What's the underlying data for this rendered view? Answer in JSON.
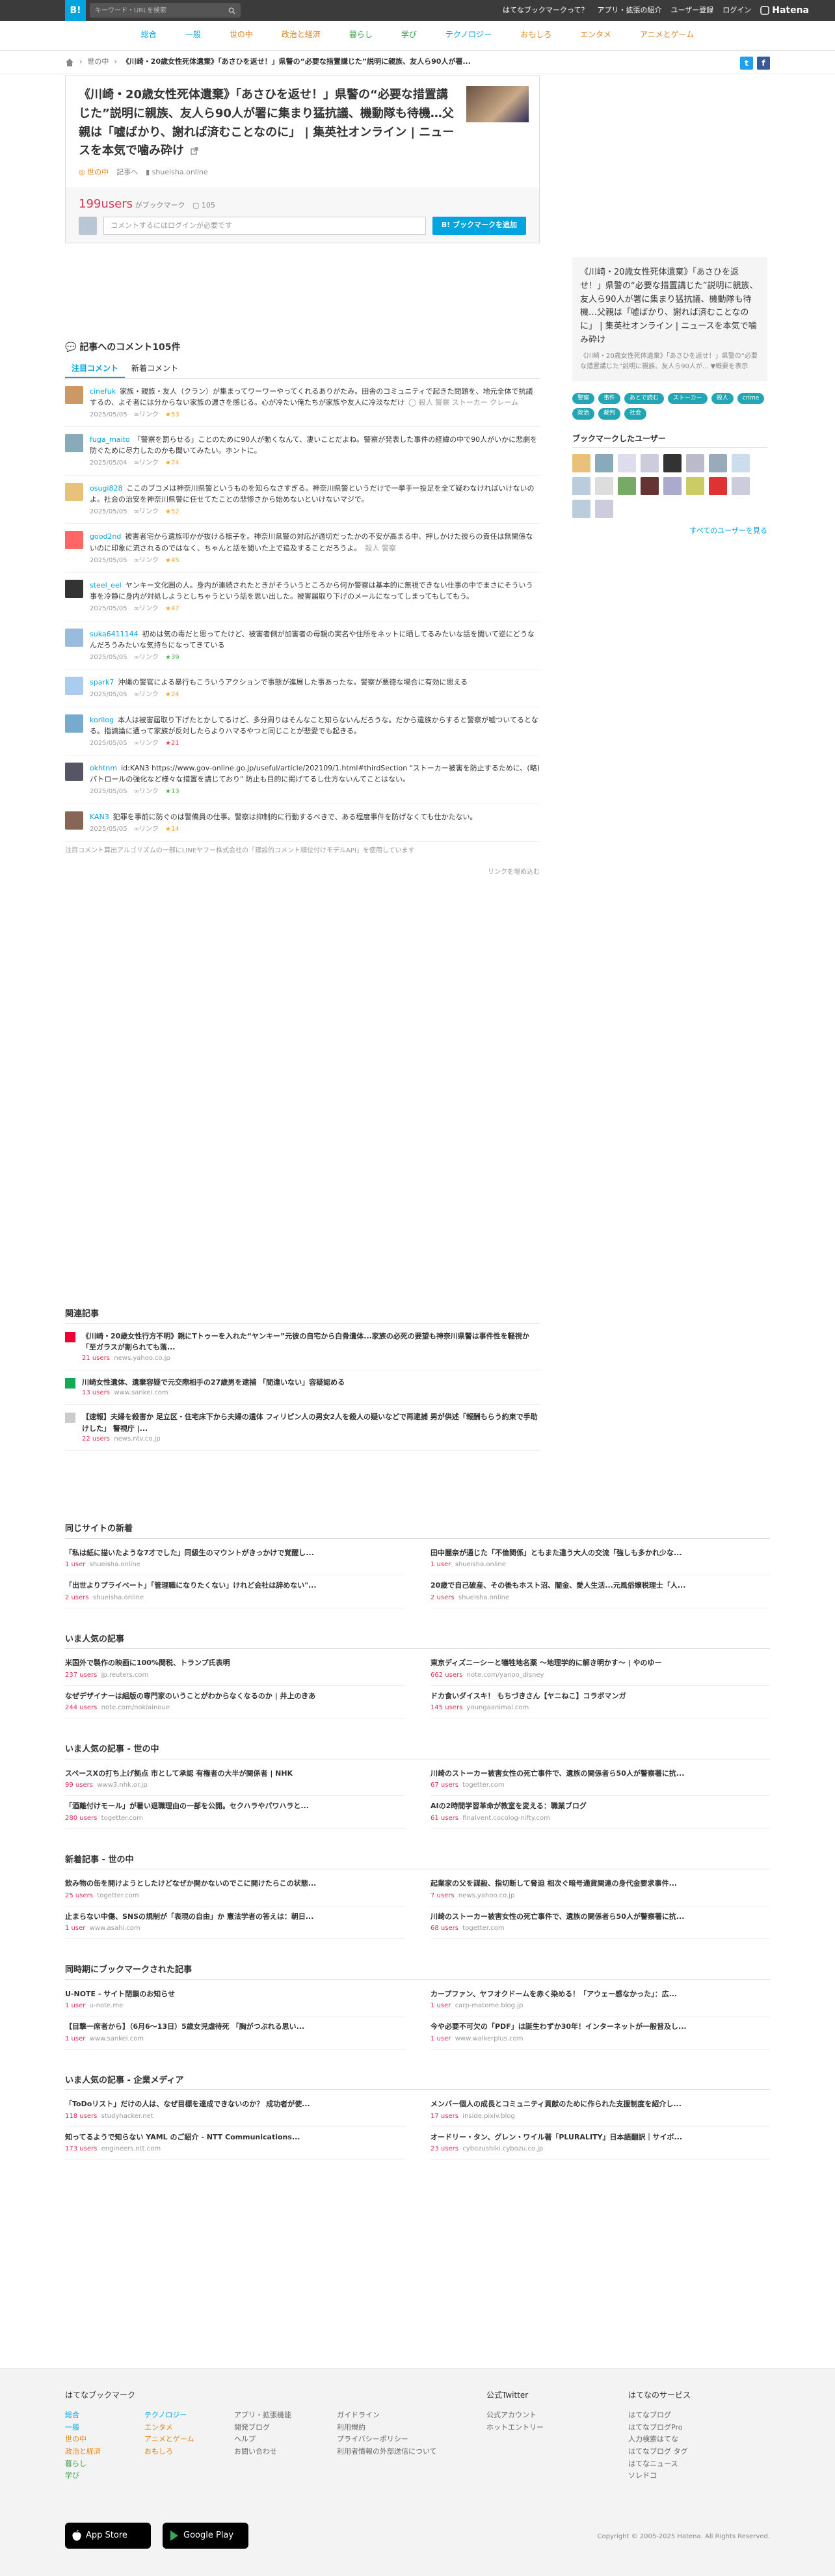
{
  "topbar": {
    "logo": "B!",
    "search_placeholder": "キーワード・URLを検索",
    "links": [
      "はてなブックマークって？",
      "アプリ・拡張の紹介",
      "ユーザー登録",
      "ログイン"
    ],
    "hatena": "Hatena"
  },
  "categories": [
    "総合",
    "一般",
    "世の中",
    "政治と経済",
    "暮らし",
    "学び",
    "テクノロジー",
    "おもしろ",
    "エンタメ",
    "アニメとゲーム"
  ],
  "breadcrumb": {
    "category": "世の中",
    "title": "《川崎・20歳女性死体遺棄》「あさひを返せ！」県警の“必要な措置講じた”説明に親族、友人ら90人が署..."
  },
  "entry": {
    "title": "《川崎・20歳女性死体遺棄》「あさひを返せ！」県警の“必要な措置講じた”説明に親族、友人ら90人が署に集まり猛抗議、機動隊も待機…父親は「嘘ばかり、謝れば済むことなのに」 | 集英社オンライン | ニュースを本気で噛み砕け",
    "category": "世の中",
    "meta_label": "記事へ",
    "domain": "shueisha.online",
    "users": "199users",
    "bm_label": "がブックマーク",
    "comment_count": "105",
    "comment_placeholder": "コメントするにはログインが必要です",
    "add_button": "ブックマークを追加"
  },
  "comments_header": "記事へのコメント105件",
  "tabs": [
    "注目コメント",
    "新着コメント"
  ],
  "comments": [
    {
      "user": "cinefuk",
      "text": "家族・親族・友人（クラン）が集まってワーワーやってくれるありがたみ。田舎のコミュニティで起きた問題を、地元全体で抗議するの、よそ者には分からない家族の濃さを感じる。心が冷たい俺たちが家族や友人に冷淡なだけ",
      "tags": "◯ 殺人 警察 ストーカー クレーム",
      "date": "2025/05/05",
      "stars": "★53"
    },
    {
      "user": "fuga_maito",
      "text": "「警察を罰らせる」ことのために90人が動くなんて、凄いことだよね。警察が発表した事件の経緯の中で90人がいかに悲劇を防ぐために尽力したのかも聞いてみたい。ホントに。",
      "tags": "",
      "date": "2025/05/04",
      "stars": "★74"
    },
    {
      "user": "osugi828",
      "text": "ここのブコメは神奈川県警というものを知らなさすぎる。神奈川県警というだけで一挙手一投足を全て疑わなければいけないのよ。社会の治安を神奈川県警に任せてたことの悲惨さから始めないといけないマジで。",
      "tags": "",
      "date": "2025/05/05",
      "stars": "★52"
    },
    {
      "user": "good2nd",
      "text": "被害者宅から遺族叩かが抜ける様子を。神奈川県警の対応が適切だったかの不安が高まる中、押しかけた彼らの責任は無関係ないのに印象に流されるのではなく、ちゃんと話を聞いた上で追及することだろうよ。",
      "tags": "殺人 警察",
      "date": "2025/05/05",
      "stars": "★45"
    },
    {
      "user": "steel_eel",
      "text": "ヤンキー文化圏の人。身内が連続されたときがそういうところから何か警察は基本的に無視できない仕事の中でまさにそういう事を冷静に身内が対処しようとしちゃうという話を思い出した。被害届取り下げのメールになってしまってもしてもう。",
      "tags": "",
      "date": "2025/05/05",
      "stars": "★47"
    },
    {
      "user": "suka6411144",
      "text": "初めは気の毒だと思ってたけど、被害者側が加害者の母親の実名や住所をネットに晒してるみたいな話を聞いて逆にどうなんだろうみたいな気持ちになってきている",
      "tags": "",
      "date": "2025/05/05",
      "stars": "★39"
    },
    {
      "user": "spark7",
      "text": "沖縄の警官による暴行もこういうアクションで事態が進展した事あったな。警察が悪徳な場合に有効に思える",
      "tags": "",
      "date": "2025/05/05",
      "stars": "★24"
    },
    {
      "user": "korilog",
      "text": "本人は被害届取り下げたとかしてるけど、多分周りはそんなこと知らないんだろうな。だから遺族からすると警察が嘘ついてるとなる。指謫論に遭って家族が反対したらよりハマるやつと同じことが悲愛でも起きる。",
      "tags": "",
      "date": "2025/05/05",
      "stars": "★21"
    },
    {
      "user": "okhtnm",
      "text": "id:KAN3 https://www.gov-online.go.jp/useful/article/202109/1.html#thirdSection \"ストーカー被害を防止するために、(略)パトロールの強化など様々な措置を講じており\" 防止も目的に掲げてるし仕方ないんてことはない。",
      "tags": "",
      "date": "2025/05/05",
      "stars": "★13"
    },
    {
      "user": "KAN3",
      "text": "犯罪を事前に防ぐのは警備員の仕事。警察は抑制的に行動するべきで、ある程度事件を防げなくても仕かたない。",
      "tags": "",
      "date": "2025/05/05",
      "stars": "★14"
    }
  ],
  "ai_note": "注目コメント算出アルゴリズムの一部にLINEヤフー株式会社の「建設的コメント順位付けモデルAPI」を使用しています",
  "link_more": "リンクを埋め込む",
  "side": {
    "title": "《川崎・20歳女性死体遺棄》「あさひを返せ！」県警の“必要な措置講じた”説明に親族、友人ら90人が署に集まり猛抗議、機動隊も待機…父親は「嘘ばかり、謝れば済むことなのに」 | 集英社オンライン | ニュースを本気で噛み砕け",
    "desc": "《川崎・20歳女性死体遺棄》「あさひを返せ！」県警の“必要な措置講じた”説明に親族、友人ら90人が... ▼概要を表示",
    "tags": [
      "警察",
      "事件",
      "あとで読む",
      "ストーカー",
      "殺人",
      "crime",
      "政治",
      "裁判",
      "社会"
    ],
    "bm_users": "ブックマークしたユーザー",
    "see_all": "すべてのユーザーを見る"
  },
  "related": {
    "header": "関連記事",
    "items": [
      {
        "title": "《川崎・20歳女性行方不明》親にTトゥーを入れた“ヤンキー”元彼の自宅から白骨遺体...家族の必死の要望も神奈川県警は事件性を軽視か「至ガラスが割られても落...",
        "users": "21 users",
        "domain": "news.yahoo.co.jp"
      },
      {
        "title": "川崎女性遺体、遺棄容疑で元交際相手の27歳男を逮捕 「間違いない」容疑認める",
        "users": "13 users",
        "domain": "www.sankei.com"
      },
      {
        "title": "【速報】夫婦を殺害か 足立区・住宅床下から夫婦の遺体 フィリピン人の男女2人を殺人の疑いなどで再逮捕 男が供述「報酬もらう約束で手助けした」 警視庁 |...",
        "users": "22 users",
        "domain": "news.ntv.co.jp"
      }
    ]
  },
  "sections": [
    {
      "header": "同じサイトの新着",
      "items": [
        {
          "title": "「私は紙に描いたような7才でした」同級生のマウントがきっかけで覚醒し...",
          "users": "1 user",
          "domain": "shueisha.online"
        },
        {
          "title": "田中麗奈が通じた「不倫関係」ともまた違う大人の交流「強しも多かれ少な...",
          "users": "1 user",
          "domain": "shueisha.online"
        },
        {
          "title": "「出世よりプライベート」「管理職になりたくない」けれど会社は辞めない\"...",
          "users": "2 users",
          "domain": "shueisha.online"
        },
        {
          "title": "20歳で自己破産、その後もホスト沼、闇金、愛人生活...元風俗嬢税理士「人...",
          "users": "2 users",
          "domain": "shueisha.online"
        }
      ]
    },
    {
      "header": "いま人気の記事",
      "items": [
        {
          "title": "米国外で製作の映画に100%関税、トランプ氏表明",
          "users": "237 users",
          "domain": "jp.reuters.com"
        },
        {
          "title": "東京ディズニーシーと犠牲地名薬 〜地理学的に解き明かす〜 | やのゆー",
          "users": "662 users",
          "domain": "note.com/yanoo_disney"
        },
        {
          "title": "なぜデザイナーは組版の専門家のいうことがわからなくなるのか | 井上のきあ",
          "users": "244 users",
          "domain": "note.com/nokiainoue"
        },
        {
          "title": "ドカ食いダイスキ！ もちづきさん【ヤニねこ】コラボマンガ",
          "users": "145 users",
          "domain": "youngaanimal.com"
        }
      ]
    },
    {
      "header": "いま人気の記事 - 世の中",
      "items": [
        {
          "title": "スペースXの打ち上げ拠点 市として承認 有権者の大半が関係者 | NHK",
          "users": "99 users",
          "domain": "www3.nhk.or.jp"
        },
        {
          "title": "川崎のストーカー被害女性の死亡事件で、遺族の関係者ら50人が警察署に抗...",
          "users": "67 users",
          "domain": "togetter.com"
        },
        {
          "title": "「酒離付けモール」が暑い退職理由の一部を公開。セクハラやパワハラと...",
          "users": "280 users",
          "domain": "togetter.com"
        },
        {
          "title": "AIの2時間学習革命が教室を変える：職業ブログ",
          "users": "61 users",
          "domain": "finalvent.cocolog-nifty.com"
        }
      ]
    },
    {
      "header": "新着記事 - 世の中",
      "items": [
        {
          "title": "飲み物の缶を開けようとしたけどなぜか開かないのでこに開けたらこの状態...",
          "users": "25 users",
          "domain": "togetter.com"
        },
        {
          "title": "起業家の父を謀殺、指切断して脅迫 相次ぐ暗号通貨関連の身代金要求事件...",
          "users": "7 users",
          "domain": "news.yahoo.co.jp"
        },
        {
          "title": "止まらない中傷、SNSの規制が「表現の自由」か 憲法学者の答えは：朝日...",
          "users": "1 user",
          "domain": "www.asahi.com"
        },
        {
          "title": "川崎のストーカー被害女性の死亡事件で、遺族の関係者ら50人が警察署に抗...",
          "users": "68 users",
          "domain": "togetter.com"
        }
      ]
    },
    {
      "header": "同時期にブックマークされた記事",
      "items": [
        {
          "title": "U-NOTE - サイト閉鎖のお知らせ",
          "users": "1 user",
          "domain": "u-note.me"
        },
        {
          "title": "カープファン、ヤフオクドームを赤く染める！「アウェー感なかった」：広...",
          "users": "1 user",
          "domain": "carp-matome.blog.jp"
        },
        {
          "title": "【目撃一席者から】（6月6〜13日）5歳女児虐待死 「胸がつぶれる思い...",
          "users": "1 user",
          "domain": "www.sankei.com"
        },
        {
          "title": "今や必要不可欠の「PDF」は誕生わずか30年！インターネットが一般普及し...",
          "users": "1 user",
          "domain": "www.walkerplus.com"
        }
      ]
    },
    {
      "header": "いま人気の記事 - 企業メディア",
      "items": [
        {
          "title": "「ToDoリスト」だけの人は、なぜ目標を達成できないのか？ 成功者が使...",
          "users": "118 users",
          "domain": "studyhacker.net"
        },
        {
          "title": "メンバー個人の成長とコミュニティ貢献のために作られた支援制度を紹介し...",
          "users": "17 users",
          "domain": "inside.pixiv.blog"
        },
        {
          "title": "知ってるようで知らない YAML のご紹介 - NTT Communications...",
          "users": "173 users",
          "domain": "engineers.ntt.com"
        },
        {
          "title": "オードリー・タン、グレン・ワイル著「PLURALITY」日本語翻訳｜サイボ...",
          "users": "23 users",
          "domain": "cybozushiki.cybozu.co.jp"
        }
      ]
    }
  ],
  "footer": {
    "col1_head": "はてなブックマーク",
    "col1a": [
      "総合",
      "一般",
      "世の中",
      "政治と経済",
      "暮らし",
      "学び"
    ],
    "col1b": [
      "テクノロジー",
      "エンタメ",
      "アニメとゲーム",
      "おもしろ"
    ],
    "col2": [
      "アプリ・拡張機能",
      "開発ブログ",
      "ヘルプ",
      "お問い合わせ"
    ],
    "col3": [
      "ガイドライン",
      "利用規約",
      "プライバシーポリシー",
      "利用者情報の外部送信について"
    ],
    "col4_head": "公式Twitter",
    "col4": [
      "公式アカウント",
      "ホットエントリー"
    ],
    "col5_head": "はてなのサービス",
    "col5": [
      "はてなブログ",
      "はてなブログPro",
      "人力検索はてな",
      "はてなブログ タグ",
      "はてなニュース",
      "ソレドコ"
    ],
    "appstore": "App Store",
    "googleplay": "Google Play",
    "copyright": "Copyright © 2005-2025 Hatena. All Rights Reserved."
  },
  "colors": {
    "accent": "#00a4de",
    "users": "#dd3355",
    "star": "#f5a623",
    "tag": "#22a6b3"
  }
}
